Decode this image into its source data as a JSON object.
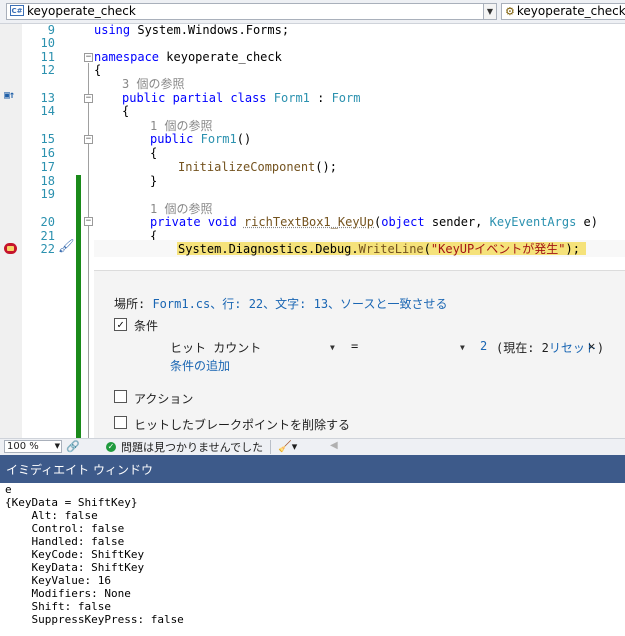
{
  "navbar": {
    "project_combo": "keyoperate_check",
    "class_combo": "keyoperate_check.Fo",
    "cs_badge": "C#"
  },
  "code": {
    "line_numbers": [
      "9",
      "10",
      "11",
      "12",
      "13",
      "14",
      "15",
      "16",
      "17",
      "18",
      "19",
      "20",
      "21",
      "22"
    ],
    "l9_using": "using",
    "l9_ns": "System.Windows.Forms;",
    "l11_namespace": "namespace",
    "l11_name": "keyoperate_check",
    "l12_brace": "{",
    "lens_class": "3 個の参照",
    "l13_public": "public",
    "l13_partial": "partial",
    "l13_class": "class",
    "l13_name": "Form1",
    "l13_colon": " : ",
    "l13_base": "Form",
    "l14_brace": "{",
    "lens_ctor": "1 個の参照",
    "l15_public": "public",
    "l15_name": "Form1",
    "l15_parens": "()",
    "l16_brace": "{",
    "l17_call": "InitializeComponent",
    "l17_tail": "();",
    "l18_brace": "}",
    "lens_handler": "1 個の参照",
    "l20_private": "private",
    "l20_void": "void",
    "l20_method": "richTextBox1_KeyUp",
    "l20_open": "(",
    "l20_object": "object",
    "l20_sender": " sender, ",
    "l20_eventargs": "KeyEventArgs",
    "l20_e": " e)",
    "l21_brace": "{",
    "l22_stmt_a": "System.Diagnostics.Debug.",
    "l22_writeline": "WriteLine",
    "l22_open": "(",
    "l22_string": "\"KeyUPイベントが発生\"",
    "l22_close": ");"
  },
  "breakpoint_settings": {
    "location_prefix": "場所: ",
    "location_link": "Form1.cs、行: 22、文字: 13、ソースと一致させる",
    "conditions_label": "条件",
    "conditions_checked": "✓",
    "hit_count_combo": "ヒット カウント",
    "operator_combo": "=",
    "hit_value": "2",
    "current_label_open": "(現在: 2",
    "reset_link": "リセット",
    "current_label_close": ")",
    "close_glyph": "✕",
    "add_condition_link": "条件の追加",
    "actions_label": "アクション",
    "remove_bp_label": "ヒットしたブレークポイントを削除する"
  },
  "status": {
    "zoom": "100 %",
    "message": "問題は見つかりませんでした"
  },
  "immediate": {
    "title": "イミディエイト ウィンドウ",
    "lines": [
      "e",
      "{KeyData = ShiftKey}",
      "    Alt: false",
      "    Control: false",
      "    Handled: false",
      "    KeyCode: ShiftKey",
      "    KeyData: ShiftKey",
      "    KeyValue: 16",
      "    Modifiers: None",
      "    Shift: false",
      "    SuppressKeyPress: false"
    ]
  }
}
